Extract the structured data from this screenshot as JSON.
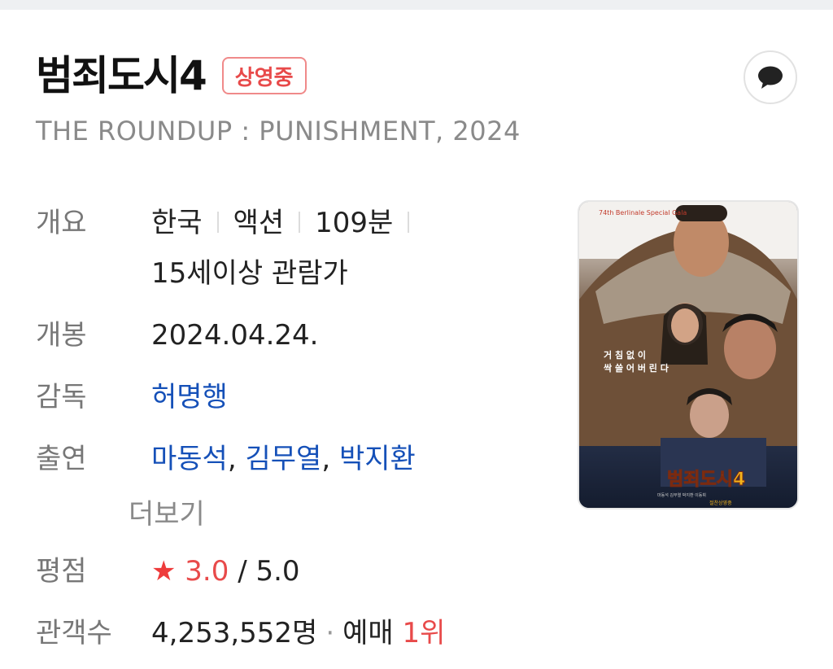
{
  "header": {
    "title": "범죄도시4",
    "badge": "상영중",
    "subtitle": "THE ROUNDUP : PUNISHMENT, 2024",
    "comment_icon": "speech-bubble-icon"
  },
  "info": {
    "overview": {
      "label": "개요",
      "country": "한국",
      "genre": "액션",
      "runtime": "109분",
      "rating": "15세이상 관람가"
    },
    "release": {
      "label": "개봉",
      "value": "2024.04.24."
    },
    "director": {
      "label": "감독",
      "name": "허명행"
    },
    "cast": {
      "label": "출연",
      "names": [
        "마동석",
        "김무열",
        "박지환"
      ],
      "separator": ",",
      "more_label": "더보기"
    },
    "score": {
      "label": "평점",
      "star_icon": "star-icon",
      "value": "3.0",
      "max": "/ 5.0"
    },
    "audience": {
      "label": "관객수",
      "count": "4,253,552명",
      "dot": "·",
      "reservation_label": "예매",
      "rank": "1위"
    }
  },
  "poster": {
    "title_text": "범죄도시4",
    "festival": "74th Berlinale Special Gala",
    "tagline_1": "거 침 없 이",
    "tagline_2": "싹 쓸 어 버 린 다",
    "cast_line": "마동석 김무열 박지환 이동휘",
    "release_line": "절찬상영중"
  },
  "colors": {
    "accent_red": "#e84a4a",
    "link_blue": "#1550b8",
    "label_gray": "#777777"
  }
}
